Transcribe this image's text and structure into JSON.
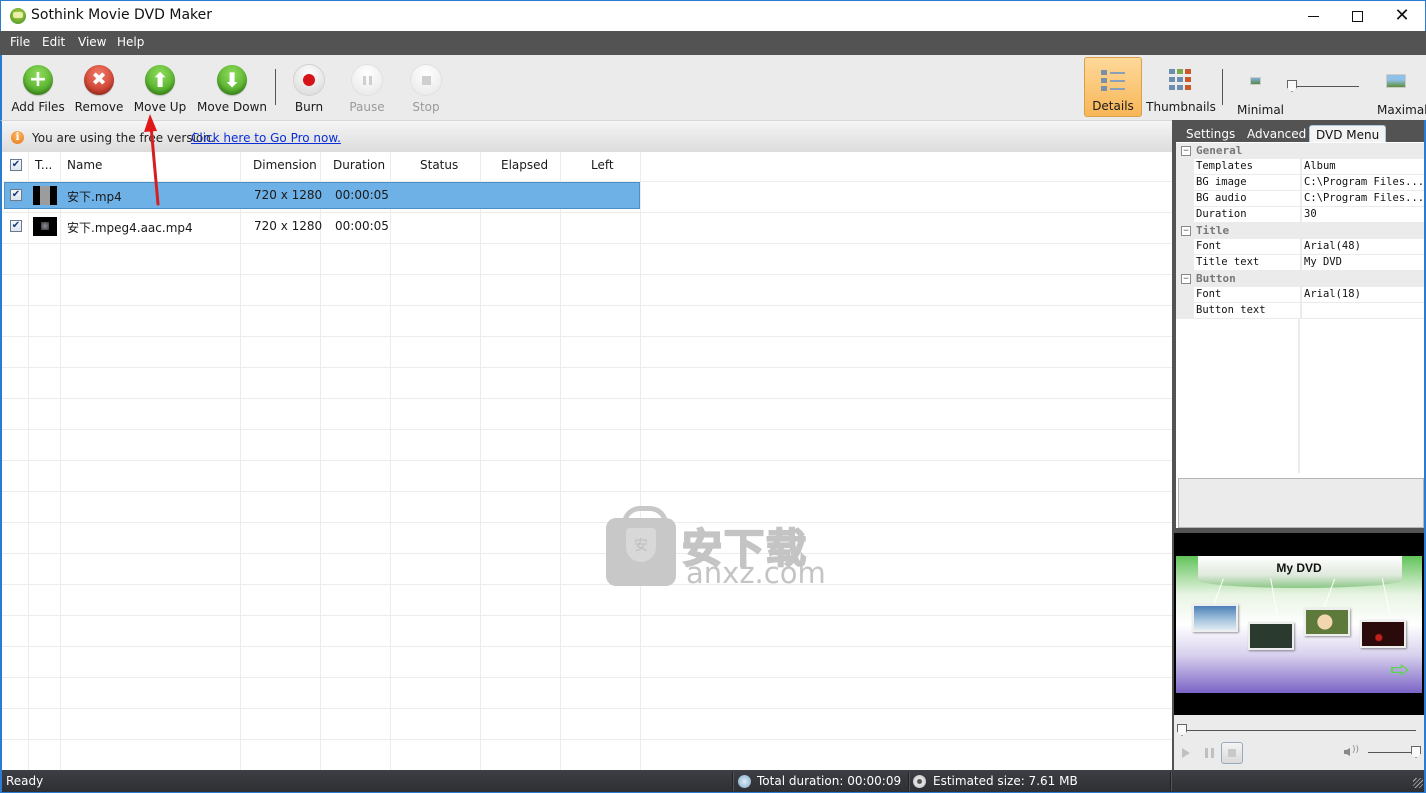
{
  "window": {
    "title": "Sothink Movie DVD Maker",
    "controls": {
      "minimize": "minimize",
      "maximize": "maximize",
      "close": "close"
    }
  },
  "menu": [
    "File",
    "Edit",
    "View",
    "Help"
  ],
  "toolbar": {
    "buttons": [
      {
        "id": "add-files",
        "label": "Add Files",
        "icon": "plus-icon",
        "enabled": true
      },
      {
        "id": "remove",
        "label": "Remove",
        "icon": "x-icon",
        "enabled": true
      },
      {
        "id": "move-up",
        "label": "Move Up",
        "icon": "arrow-up-icon",
        "enabled": true
      },
      {
        "id": "move-down",
        "label": "Move Down",
        "icon": "arrow-down-icon",
        "enabled": true
      },
      {
        "id": "burn",
        "label": "Burn",
        "icon": "record-icon",
        "enabled": true
      },
      {
        "id": "pause",
        "label": "Pause",
        "icon": "pause-icon",
        "enabled": false
      },
      {
        "id": "stop",
        "label": "Stop",
        "icon": "stop-icon",
        "enabled": false
      }
    ],
    "view_modes": [
      {
        "label": "Details",
        "active": true
      },
      {
        "label": "Thumbnails",
        "active": false
      }
    ],
    "thumb_size": {
      "min_label": "Minimal",
      "max_label": "Maximal",
      "value_fraction": 0.0
    }
  },
  "infobar": {
    "message": "You are using the free version.",
    "link": "Click here to Go Pro now."
  },
  "filelist": {
    "columns": [
      "T...",
      "Name",
      "Dimension",
      "Duration",
      "Status",
      "Elapsed",
      "Left"
    ],
    "header_checked": true,
    "rows": [
      {
        "checked": true,
        "name": "安下.mp4",
        "dimension": "720 x 1280",
        "duration": "00:00:05",
        "status": "",
        "elapsed": "",
        "left": "",
        "selected": true
      },
      {
        "checked": true,
        "name": "安下.mpeg4.aac.mp4",
        "dimension": "720 x 1280",
        "duration": "00:00:05",
        "status": "",
        "elapsed": "",
        "left": "",
        "selected": false
      }
    ]
  },
  "watermark": {
    "cn": "安下载",
    "en": "anxz.com",
    "badge": "安"
  },
  "right_panel": {
    "tabs": [
      {
        "label": "Settings",
        "active": false
      },
      {
        "label": "Advanced",
        "active": false
      },
      {
        "label": "DVD Menu",
        "active": true
      }
    ],
    "property_groups": [
      {
        "name": "General",
        "expanded": true,
        "props": [
          {
            "key": "Templates",
            "value": "Album"
          },
          {
            "key": "BG image",
            "value": "C:\\Program Files..."
          },
          {
            "key": "BG audio",
            "value": "C:\\Program Files..."
          },
          {
            "key": "Duration",
            "value": "30"
          }
        ]
      },
      {
        "name": "Title",
        "expanded": true,
        "props": [
          {
            "key": "Font",
            "value": "Arial(48)"
          },
          {
            "key": "Title text",
            "value": "My DVD"
          }
        ]
      },
      {
        "name": "Button",
        "expanded": true,
        "props": [
          {
            "key": "Font",
            "value": "Arial(18)"
          },
          {
            "key": "Button text",
            "value": ""
          }
        ]
      }
    ],
    "preview": {
      "title": "My DVD",
      "seek_fraction": 0.0,
      "volume_fraction": 1.0
    }
  },
  "statusbar": {
    "status": "Ready",
    "total_duration": "Total duration: 00:00:09",
    "estimated_size": "Estimated size: 7.61 MB"
  },
  "colors": {
    "accent": "#2b7bd0",
    "selection": "#6eb1e7",
    "menubar": "#535353",
    "active_view": "#f7b657",
    "link": "#0a2fd6"
  }
}
